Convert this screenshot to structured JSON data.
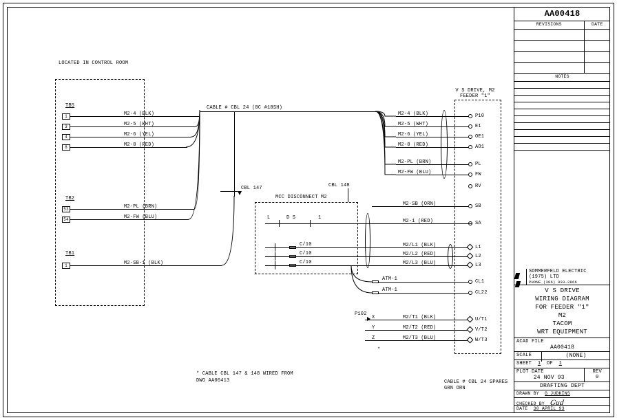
{
  "drawing_number": "AA00418",
  "rev_header": {
    "col1": "REVISIONS",
    "col2": "DATE"
  },
  "notes_header": "NOTES",
  "company": {
    "name": "SOMMERFELD ELECTRIC",
    "sub": "(1975) LTD",
    "phone": "PHONE (306) 933-2866"
  },
  "title": {
    "l1": "V S DRIVE",
    "l2": "WIRING DIAGRAM",
    "l3": "FOR FEEDER \"1\"",
    "l4": "M2",
    "l5": "TACOM",
    "l6": "WRT EQUIPMENT"
  },
  "acad": {
    "label": "ACAD FILE",
    "value": "AA00418"
  },
  "scale": {
    "label": "SCALE",
    "value": "(NONE)"
  },
  "sheet": {
    "label": "SHEET",
    "a": "1",
    "mid": "OF",
    "b": "1"
  },
  "plot": {
    "label": "PLOT DATE",
    "value": "24 NOV 93",
    "revlabel": "REV",
    "rev": "0"
  },
  "dept": "DRAFTING DEPT",
  "drawn": {
    "label": "DRAWN BY",
    "value": "G JUDKINS"
  },
  "checked": {
    "label": "CHECKED BY",
    "value": "(signature)"
  },
  "date2": {
    "label": "DATE",
    "value": "30 APRIL 93"
  },
  "loc": "LOCATED IN CONTROL ROOM",
  "tb": {
    "tb5": "TB5",
    "tb2": "TB2",
    "tb1": "TB1"
  },
  "cable_main": "CABLE #  CBL 24  (8C #18SH)",
  "cbl147": "CBL 147",
  "cbl148": "CBL 148",
  "mcc": "MCC DISCONNECT M2",
  "vsd": {
    "l1": "V S DRIVE, M2",
    "l2": "FEEDER \"1\""
  },
  "left_tb5": [
    {
      "pin": "1",
      "label": "M2-4  (BLK)"
    },
    {
      "pin": "3",
      "label": "M2-5  (WHT)"
    },
    {
      "pin": "4",
      "label": "M2-6  (YEL)"
    },
    {
      "pin": "8",
      "label": "M2-8  (RED)"
    }
  ],
  "left_tb2": [
    {
      "pin": "53",
      "label": "M2-PL  (BRN)"
    },
    {
      "pin": "54",
      "label": "M2-FW  (BLU)"
    }
  ],
  "left_tb1": {
    "pin": "1",
    "label": "M2-SB-1  (BLK)"
  },
  "right_top": [
    {
      "wire": "M2-4  (BLK)",
      "dst": "P10"
    },
    {
      "wire": "M2-5  (WHT)",
      "dst": "E1"
    },
    {
      "wire": "M2-6  (YEL)",
      "dst": "OE1"
    },
    {
      "wire": "M2-8  (RED)",
      "dst": "AO1"
    },
    {
      "wire": "M2-PL  (BRN)",
      "dst": "PL"
    },
    {
      "wire": "M2-FW  (BLU)",
      "dst": "FW"
    }
  ],
  "right_rv": "RV",
  "right_sb": {
    "wire": "M2-SB  (ORN)",
    "dst": "SB"
  },
  "right_sa": {
    "wire": "M2-1  (RED)",
    "dst": "SA"
  },
  "right_l": [
    {
      "wire": "M2/L1 (BLK)",
      "dst": "L1"
    },
    {
      "wire": "M2/L2 (RED)",
      "dst": "L2"
    },
    {
      "wire": "M2/L3 (BLU)",
      "dst": "L3"
    }
  ],
  "atm": {
    "label": "ATM-1",
    "dst1": "CL1",
    "dst2": "CL22"
  },
  "p102": "P102",
  "xyz": {
    "x": "X",
    "y": "Y",
    "z": "Z"
  },
  "right_t": [
    {
      "wire": "M2/T1 (BLK)",
      "dst": "U/T1"
    },
    {
      "wire": "M2/T2 (RED)",
      "dst": "V/T2"
    },
    {
      "wire": "M2/T3 (BLU)",
      "dst": "W/T3"
    }
  ],
  "mcc_int": {
    "L": "L",
    "DS": "D S",
    "one": "1",
    "cj": "C/10"
  },
  "foot1": "* CABLE CBL 147 & 148 WIRED FROM",
  "foot2": "  DWG AA00413",
  "foot3a": "CABLE #  CBL 24 SPARES",
  "foot3b": "GRN  ORN"
}
